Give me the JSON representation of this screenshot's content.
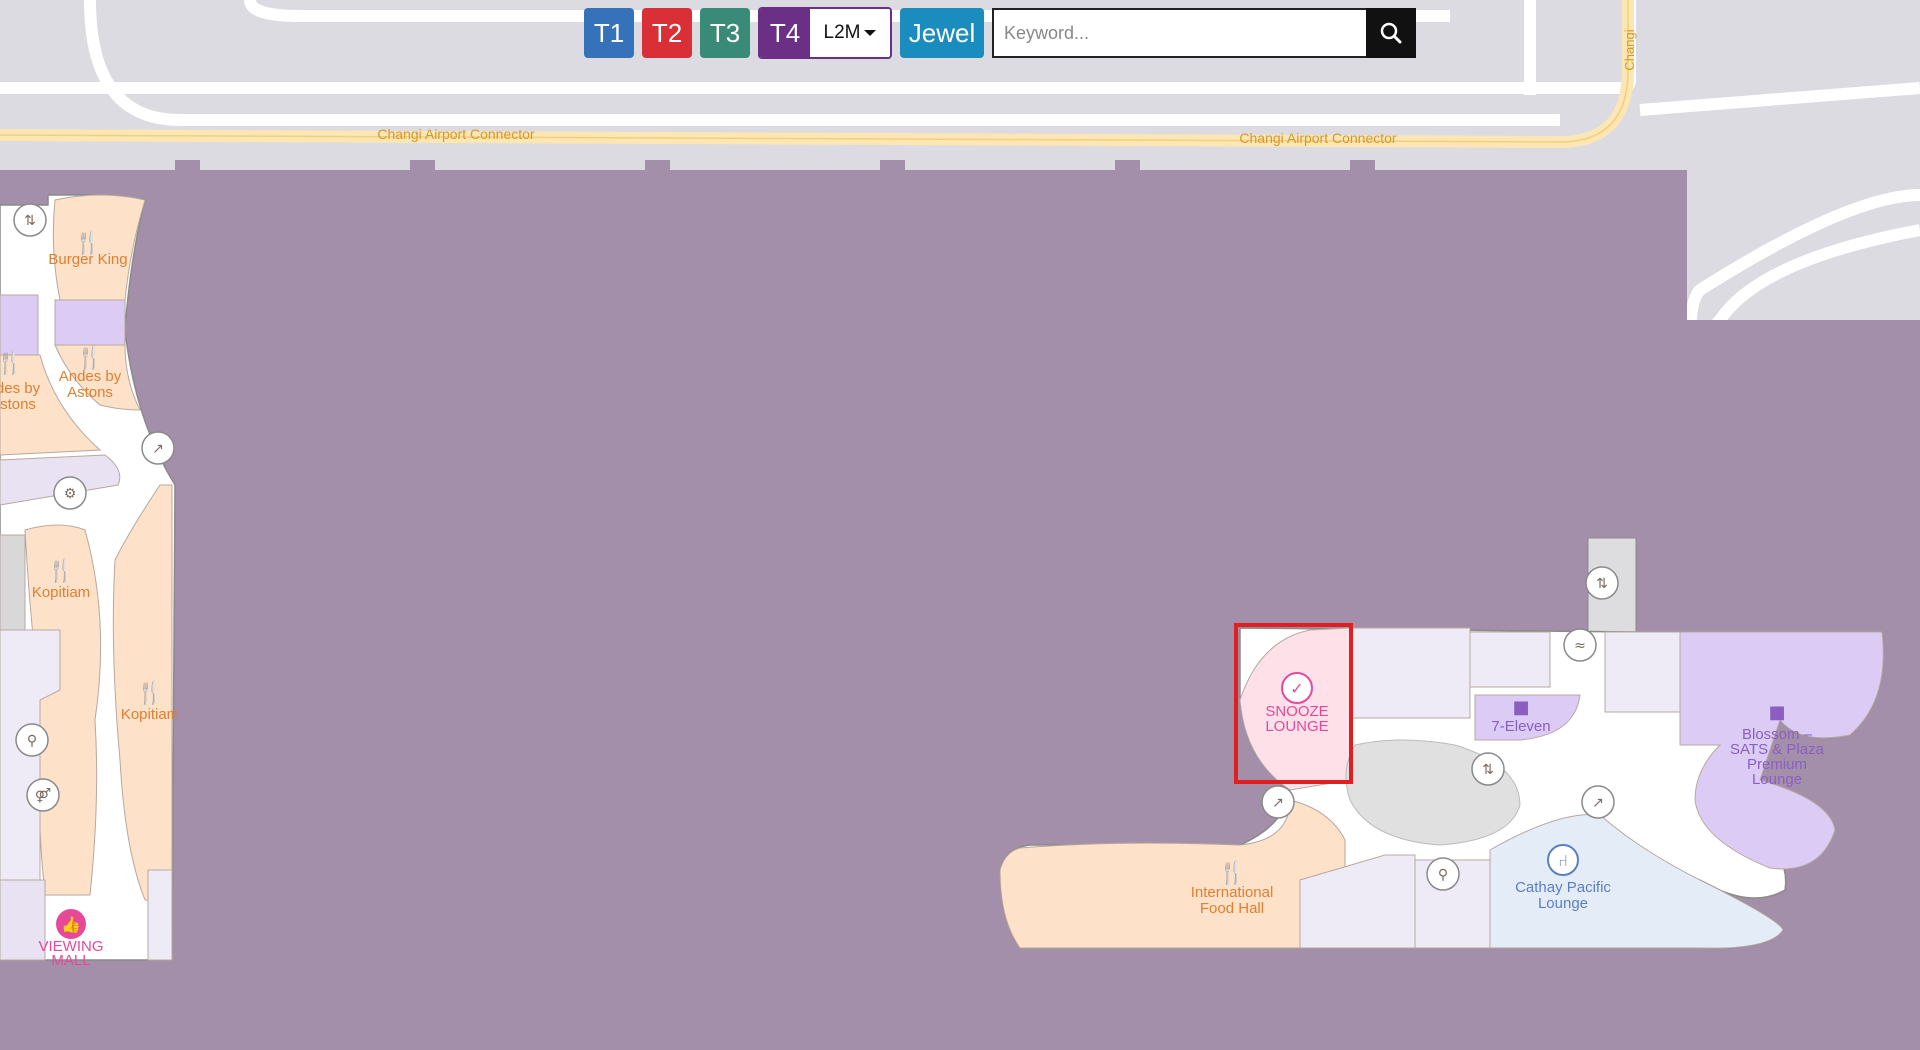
{
  "toolbar": {
    "terminals": [
      "T1",
      "T2",
      "T3",
      "T4"
    ],
    "level": "L2M",
    "jewel_label": "Jewel",
    "search_placeholder": "Keyword..."
  },
  "roads": {
    "connector_label_1": "Changi Airport Connector",
    "connector_label_2": "Changi Airport Connector",
    "vertical_label": "Changi"
  },
  "places": {
    "burger_king": "Burger King",
    "andes_1_line1": "Andes by",
    "andes_1_line2": "Astons",
    "andes_2_line1": "des by",
    "andes_2_line2": "stons",
    "kopitiam_1": "Kopitiam",
    "kopitiam_2": "Kopitiam",
    "viewing_mall_line1": "VIEWING",
    "viewing_mall_line2": "MALL",
    "snooze_line1": "SNOOZE",
    "snooze_line2": "LOUNGE",
    "seven_eleven": "7-Eleven",
    "blossom_line1": "Blossom –",
    "blossom_line2": "SATS & Plaza",
    "blossom_line3": "Premium",
    "blossom_line4": "Lounge",
    "food_hall_line1": "International",
    "food_hall_line2": "Food Hall",
    "cathay_line1": "Cathay Pacific",
    "cathay_line2": "Lounge"
  },
  "colors": {
    "tarmac": "#a48faa",
    "road": "#dcdbe1",
    "food": "#fde1c8",
    "food_text": "#e07f2f",
    "retail": "#dccbf4",
    "retail_text": "#8b5fc0",
    "lounge": "#fde0e8",
    "lounge_text": "#e8489a",
    "cathay": "#e4ecf8",
    "cathay_text": "#5b7fc4",
    "highlight": "#e02020"
  },
  "highlighted_place": "Snooze Lounge"
}
